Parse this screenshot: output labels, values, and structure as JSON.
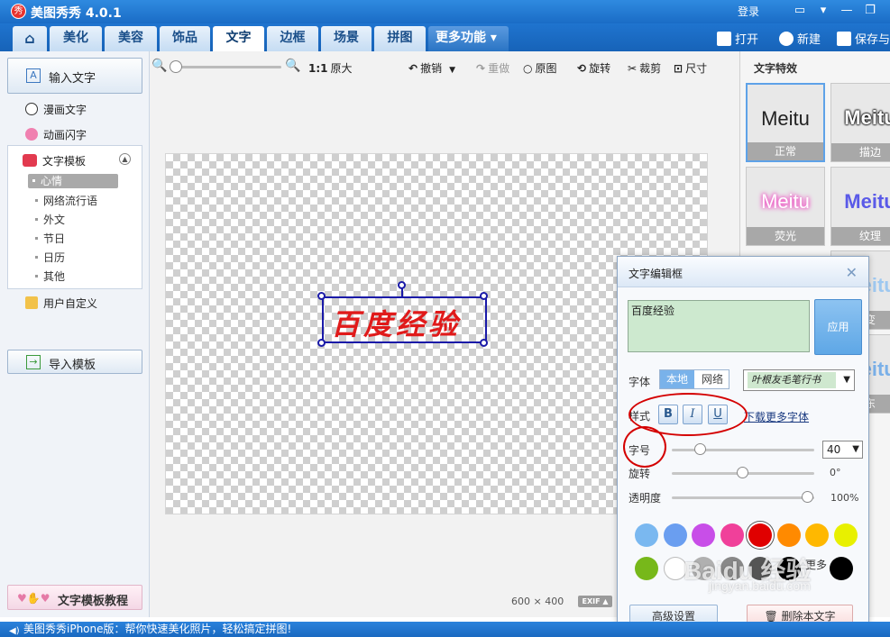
{
  "app": {
    "title": "美图秀秀 4.0.1",
    "logo_text": "秀"
  },
  "titlebar": {
    "login": "登录"
  },
  "tabs": [
    {
      "label": "⌂"
    },
    {
      "label": "美化"
    },
    {
      "label": "美容"
    },
    {
      "label": "饰品"
    },
    {
      "label": "文字"
    },
    {
      "label": "边框"
    },
    {
      "label": "场景"
    },
    {
      "label": "拼图"
    }
  ],
  "more_tab": "更多功能 ▾",
  "actions": {
    "open": "打开",
    "new": "新建",
    "save": "保存与"
  },
  "left": {
    "input_text": "输入文字",
    "comic_text": "漫画文字",
    "animated_text": "动画闪字",
    "templates_title": "文字模板",
    "template_items": [
      "心情",
      "网络流行语",
      "外文",
      "节日",
      "日历",
      "其他"
    ],
    "custom": "用户自定义",
    "import_template": "导入模板",
    "tutorial": "文字模板教程"
  },
  "toolbar": {
    "zoom_original": "原大",
    "ratio": "1:1",
    "undo": "撤销",
    "redo": "重做",
    "original": "原图",
    "rotate": "旋转",
    "crop": "裁剪",
    "size": "尺寸"
  },
  "canvas": {
    "sample_text": "百度经验",
    "dims_w": "600",
    "dims_x": "×",
    "dims_h": "400",
    "exif": "EXIF ▲"
  },
  "effects": {
    "title": "文字特效",
    "items": [
      {
        "preview": "Meitu",
        "label": "正常"
      },
      {
        "preview": "Meitu",
        "label": "描边"
      },
      {
        "preview": "Meitu",
        "label": "荧光"
      },
      {
        "preview": "Meitu",
        "label": "纹理"
      },
      {
        "preview": "Meitu",
        "label": "变"
      },
      {
        "preview": "Meitu",
        "label": "东"
      }
    ]
  },
  "dialog": {
    "title": "文字编辑框",
    "text_value": "百度经验",
    "apply": "应用",
    "font_label": "字体",
    "font_local": "本地",
    "font_web": "网络",
    "font_selected": "叶根友毛笔行书",
    "style_label": "样式",
    "bold": "B",
    "italic": "I",
    "underline": "U",
    "download_fonts": "下载更多字体",
    "size_label": "字号",
    "size_value": "40",
    "rotate_label": "旋转",
    "rotate_value": "0°",
    "opacity_label": "透明度",
    "opacity_value": "100%",
    "more_colors": "更多",
    "advanced": "高级设置",
    "delete": "删除本文字"
  },
  "colors": [
    "#7ab8f0",
    "#6a9ef0",
    "#c84ee8",
    "#f0409a",
    "#e00000",
    "#ff8a00",
    "#ffb800",
    "#e8f000",
    "#77b81a",
    "#ffffff",
    "#b0b0b0",
    "#888888",
    "#555555",
    "#000000",
    "#000000"
  ],
  "watermark": {
    "brand": "Baidu 经验",
    "url": "jingyan.baidu.com"
  },
  "statusbar": {
    "message": "美图秀秀iPhone版：帮你快速美化照片，轻松搞定拼图!"
  }
}
